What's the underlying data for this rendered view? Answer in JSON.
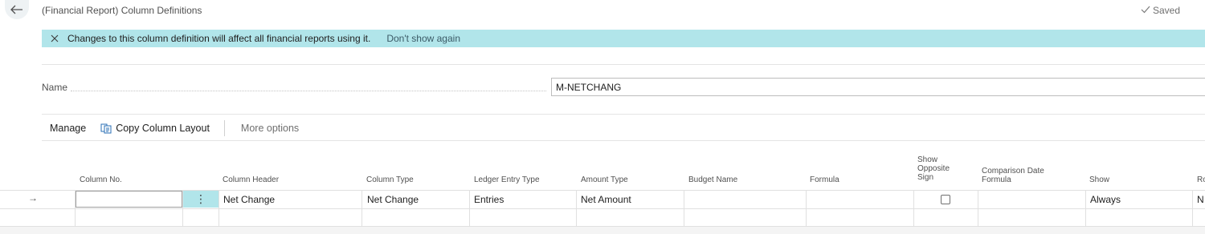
{
  "header": {
    "title": "(Financial Report) Column Definitions",
    "saved_label": "Saved",
    "back_icon": "arrow-left-icon",
    "saved_icon": "checkmark-icon"
  },
  "banner": {
    "message": "Changes to this column definition will affect all financial reports using it.",
    "link": "Don't show again",
    "color": "#b1e5ea"
  },
  "form": {
    "name_label": "Name",
    "name_value": "M-NETCHANG"
  },
  "actions": {
    "manage": "Manage",
    "copy_layout": "Copy Column Layout",
    "more_options": "More options"
  },
  "table": {
    "headers": {
      "column_no": "Column No.",
      "column_header": "Column Header",
      "column_type": "Column Type",
      "ledger_entry_type": "Ledger Entry Type",
      "amount_type": "Amount Type",
      "budget_name": "Budget Name",
      "formula": "Formula",
      "show_opposite_sign": [
        "Show",
        "Opposite",
        "Sign"
      ],
      "comparison_date_formula": [
        "Comparison Date",
        "Formula"
      ],
      "show": "Show",
      "rounding": "Ro"
    },
    "rows": [
      {
        "column_no": "",
        "column_header": "Net Change",
        "column_type": "Net Change",
        "ledger_entry_type": "Entries",
        "amount_type": "Net Amount",
        "budget_name": "",
        "formula": "",
        "show_opposite_sign": false,
        "comparison_date_formula": "",
        "show": "Always",
        "rounding": "N"
      }
    ]
  }
}
